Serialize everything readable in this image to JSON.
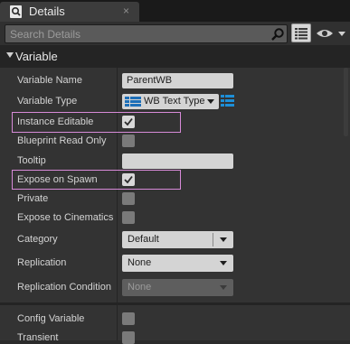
{
  "tab": {
    "title": "Details",
    "icon": "details-magnifier-icon",
    "close": "×"
  },
  "search": {
    "placeholder": "Search Details"
  },
  "category": {
    "title": "Variable"
  },
  "properties": {
    "variable_name": {
      "label": "Variable Name",
      "value": "ParentWB"
    },
    "variable_type": {
      "label": "Variable Type",
      "value": "WB Text Type",
      "icon": "struct-type-icon",
      "container_icon": "single-variable-icon"
    },
    "instance_editable": {
      "label": "Instance Editable",
      "checked": true
    },
    "blueprint_read_only": {
      "label": "Blueprint Read Only",
      "checked": false
    },
    "tooltip": {
      "label": "Tooltip",
      "value": ""
    },
    "expose_on_spawn": {
      "label": "Expose on Spawn",
      "checked": true
    },
    "private": {
      "label": "Private",
      "checked": false
    },
    "expose_to_cinematics": {
      "label": "Expose to Cinematics",
      "checked": false
    },
    "category_field": {
      "label": "Category",
      "value": "Default"
    },
    "replication": {
      "label": "Replication",
      "value": "None"
    },
    "replication_condition": {
      "label": "Replication Condition",
      "value": "None",
      "disabled": true
    },
    "config_variable": {
      "label": "Config Variable",
      "checked": false
    },
    "transient": {
      "label": "Transient",
      "checked": false
    }
  },
  "colors": {
    "highlight": "#d78ad8",
    "panel": "#333333",
    "header": "#242424"
  }
}
